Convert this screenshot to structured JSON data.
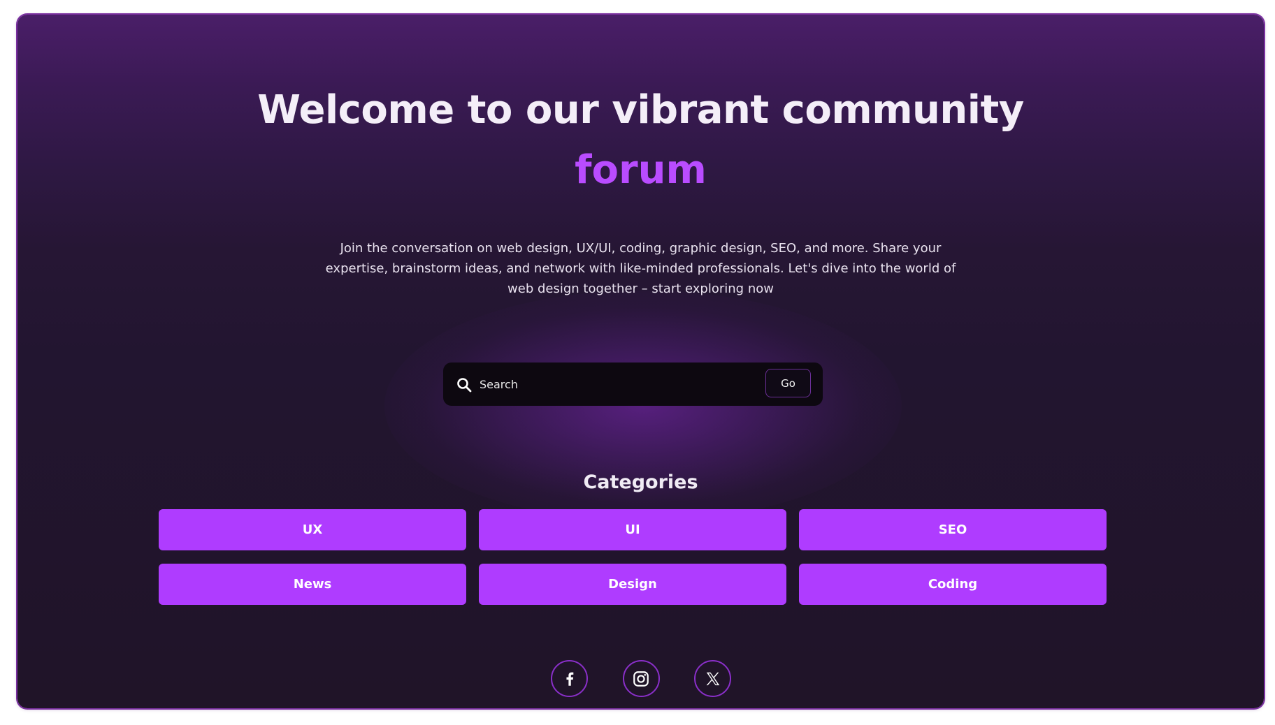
{
  "hero": {
    "title": "Welcome to our vibrant community",
    "title_accent": "forum",
    "intro": "Join the conversation on web design, UX/UI, coding, graphic design, SEO, and more. Share your expertise, brainstorm ideas, and network with like-minded professionals. Let's dive into the world of web design together – start exploring now"
  },
  "search": {
    "placeholder": "Search",
    "value": "",
    "button_label": "Go",
    "icon": "search-icon"
  },
  "categories": {
    "title": "Categories",
    "items": [
      {
        "label": "UX"
      },
      {
        "label": "UI"
      },
      {
        "label": "SEO"
      },
      {
        "label": "News"
      },
      {
        "label": "Design"
      },
      {
        "label": "Coding"
      }
    ]
  },
  "socials": [
    {
      "icon": "facebook-icon"
    },
    {
      "icon": "instagram-icon"
    },
    {
      "icon": "x-icon"
    }
  ],
  "colors": {
    "accent": "#af3cff",
    "accent_text": "#b94cff",
    "background": "#221530",
    "header_gradient_top": "#4a1e68",
    "search_bar": "#0d0810",
    "social_border": "#8a2fc9"
  }
}
